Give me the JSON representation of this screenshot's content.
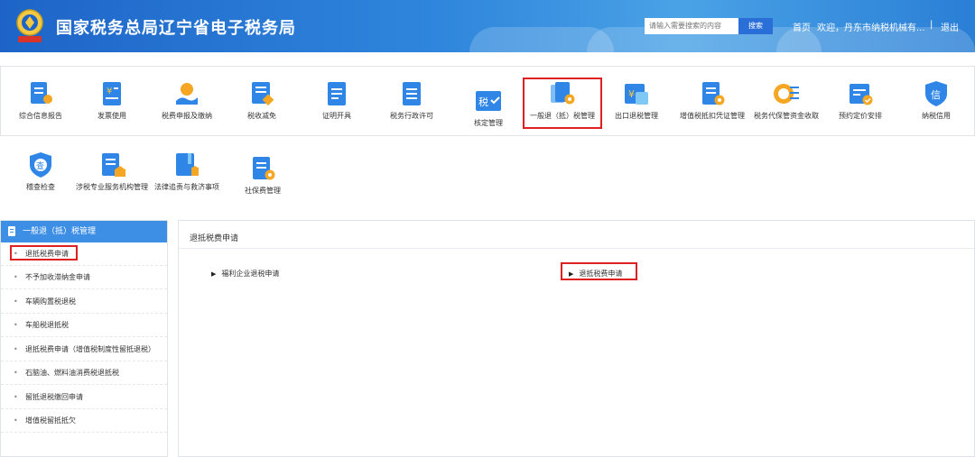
{
  "header": {
    "title": "国家税务总局辽宁省电子税务局",
    "search_placeholder": "请输入需要搜索的内容",
    "search_button": "搜索",
    "home_link": "首页",
    "welcome_text": "欢迎，丹东市纳税机械有...",
    "separator": "|",
    "logout_link": "退出"
  },
  "menu": {
    "row1": [
      {
        "label": "综合信息报告",
        "icon": "doc-mic-icon"
      },
      {
        "label": "发票使用",
        "icon": "invoice-icon"
      },
      {
        "label": "税费申报及缴纳",
        "icon": "hand-coin-icon"
      },
      {
        "label": "税收减免",
        "icon": "list-tag-icon"
      },
      {
        "label": "证明开具",
        "icon": "certificate-icon"
      },
      {
        "label": "税务行政许可",
        "icon": "document-icon"
      },
      {
        "label": "核定管理",
        "icon": "tax-check-icon"
      },
      {
        "label": "一般退（抵）税管理",
        "icon": "refund-gear-icon"
      },
      {
        "label": "出口退税管理",
        "icon": "export-refund-icon"
      },
      {
        "label": "增值税抵扣凭证管理",
        "icon": "vat-gear-icon"
      },
      {
        "label": "税务代保管资金收取",
        "icon": "coin-list-icon"
      },
      {
        "label": "预约定价安排",
        "icon": "calendar-check-icon"
      },
      {
        "label": "纳税信用",
        "icon": "credit-shield-icon"
      }
    ],
    "row2": [
      {
        "label": "稽查检查",
        "icon": "inspect-shield-icon"
      },
      {
        "label": "涉税专业服务机构管理",
        "icon": "agency-bank-icon"
      },
      {
        "label": "法律追责与救济事项",
        "icon": "law-book-icon"
      },
      {
        "label": "社保费管理",
        "icon": "social-gear-icon"
      }
    ]
  },
  "sidebar": {
    "title": "一般退（抵）税管理",
    "items": [
      "退抵税费申请",
      "不予加收滞纳金申请",
      "车辆购置税退税",
      "车船税退抵税",
      "退抵税费申请（增值税制度性留抵退税）",
      "石脑油、燃料油消费税退抵税",
      "留抵退税缴回申请",
      "增值税留抵抵欠"
    ]
  },
  "content": {
    "title": "退抵税费申请",
    "links": [
      "福利企业退税申请",
      "退抵税费申请"
    ]
  },
  "colors": {
    "header_blue": "#2f86dc",
    "sidebar_head": "#3d8fe6",
    "highlight_red": "#e02020",
    "icon_blue": "#2f86e6",
    "icon_orange": "#f5a623"
  }
}
